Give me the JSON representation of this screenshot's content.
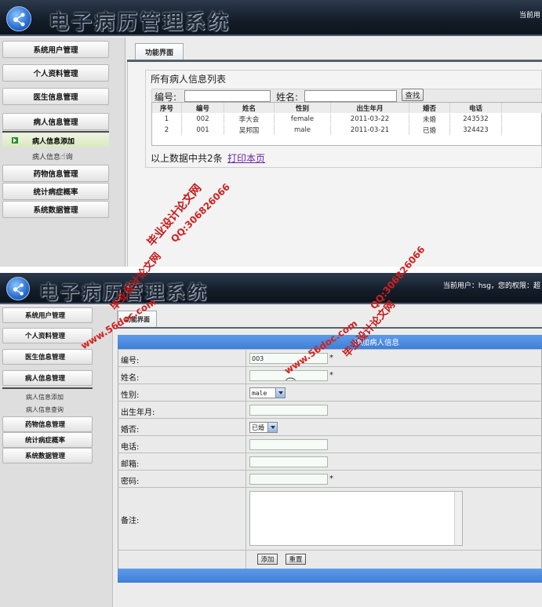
{
  "app": {
    "title": "电子病历管理系统",
    "user_info_top": "当前用",
    "user_info_bottom": "当前用户：hsg，您的权限：超"
  },
  "sidebar": {
    "items": [
      {
        "label": "系统用户管理"
      },
      {
        "label": "个人资料管理"
      },
      {
        "label": "医生信息管理"
      },
      {
        "label": "病人信息管理"
      },
      {
        "label": "病人信息添加"
      },
      {
        "label": "病人信息查询"
      },
      {
        "label": "药物信息管理"
      },
      {
        "label": "统计病症概率"
      },
      {
        "label": "系统数据管理"
      }
    ],
    "top_active_label": "病人信息添加",
    "top_query_partial": "病人信息",
    "top_query_tail": "询"
  },
  "tab": {
    "label": "功能界面"
  },
  "list": {
    "title": "所有病人信息列表",
    "filter_id_label": "编号:",
    "filter_name_label": "姓名:",
    "search_label": "查找",
    "columns": [
      "序号",
      "编号",
      "姓名",
      "性别",
      "出生年月",
      "婚否",
      "电话"
    ],
    "rows": [
      [
        "1",
        "002",
        "李大会",
        "female",
        "2011-03-22",
        "未婚",
        "243532"
      ],
      [
        "2",
        "001",
        "吴邦国",
        "male",
        "2011-03-21",
        "已婚",
        "324423"
      ]
    ],
    "footer_text": "以上数据中共2条",
    "print_label": "打印本页"
  },
  "form": {
    "title": "添加病人信息",
    "fields": {
      "id": {
        "label": "编号:",
        "value": "003",
        "required": "*"
      },
      "name": {
        "label": "姓名:",
        "value": "",
        "required": "*"
      },
      "gender": {
        "label": "性别:",
        "value": "male"
      },
      "birth": {
        "label": "出生年月:",
        "value": ""
      },
      "married": {
        "label": "婚否:",
        "value": "已婚"
      },
      "phone": {
        "label": "电话:",
        "value": ""
      },
      "email": {
        "label": "邮箱:",
        "value": ""
      },
      "password": {
        "label": "密码:",
        "value": "",
        "required": "*"
      },
      "notes": {
        "label": "备注:",
        "value": ""
      }
    },
    "add_label": "添加",
    "reset_label": "重置"
  },
  "watermarks": {
    "site": "www.56doc.com",
    "qq": "QQ:306826066",
    "brand": "毕业设计论文网"
  },
  "colors": {
    "header_bg": "#131c28",
    "form_accent": "#4a88dd",
    "link": "#6b22aa",
    "watermark": "#d42020"
  }
}
